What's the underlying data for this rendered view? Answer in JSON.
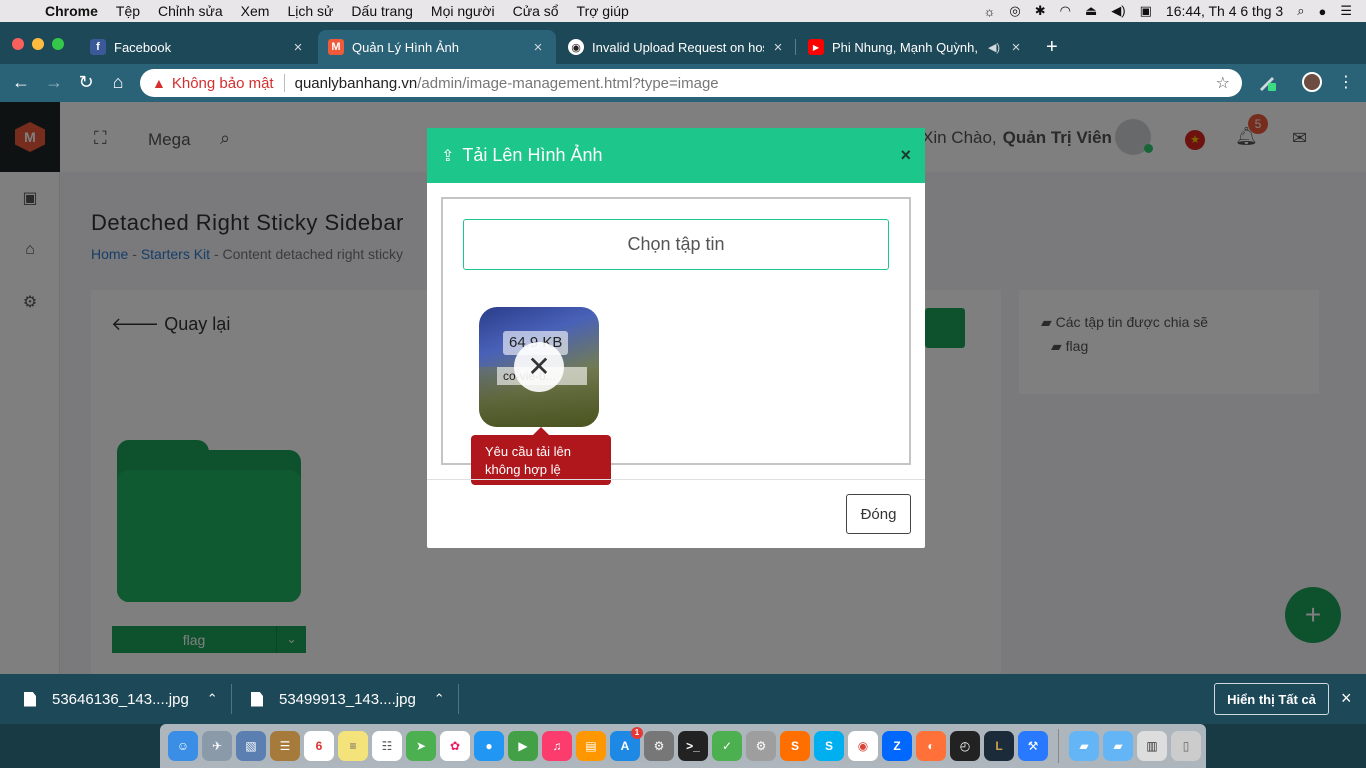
{
  "menubar": {
    "app": "Chrome",
    "items": [
      "Tệp",
      "Chỉnh sửa",
      "Xem",
      "Lịch sử",
      "Dấu trang",
      "Mọi người",
      "Cửa sổ",
      "Trợ giúp"
    ],
    "clock": "16:44, Th 4 6 thg 3"
  },
  "tabs": [
    {
      "label": "Facebook",
      "favicon": "f",
      "color": "#3b5998"
    },
    {
      "label": "Quản Lý Hình Ảnh",
      "favicon": "M",
      "color": "#ef5a3b"
    },
    {
      "label": "Invalid Upload Request on host",
      "favicon": "github-icon",
      "color": "#222222"
    },
    {
      "label": "Phi Nhung, Mạnh Quỳnh, N",
      "favicon": "youtube-icon",
      "color": "#ff0000"
    }
  ],
  "omnibox": {
    "security": "Không bảo mật",
    "host": "quanlybanhang.vn",
    "path": "/admin/image-management.html?type=image"
  },
  "app_header": {
    "logo": "M",
    "mega": "Mega",
    "greeting": "Xin Chào,",
    "user": "Quản Trị Viên",
    "notifications": "5"
  },
  "page": {
    "title": "Detached Right Sticky Sidebar",
    "breadcrumb": [
      "Home",
      "Starters Kit",
      "Content detached right sticky"
    ],
    "back_label": "Quay lại",
    "folder_name": "flag",
    "shared_header": "Các tập tin được chia sẽ",
    "shared_folder": "flag"
  },
  "modal": {
    "title": "Tải Lên Hình Ảnh",
    "choose_file": "Chọn tập tin",
    "file_size": "64.9 KB",
    "file_name": "co-vie-b...",
    "error_message": "Yêu cầu tải lên không hợp lệ",
    "close_label": "Đóng"
  },
  "downloads": {
    "items": [
      "53646136_143....jpg",
      "53499913_143....jpg"
    ],
    "show_all": "Hiển thị Tất cả"
  },
  "colors": {
    "accent": "#1dc68a",
    "error": "#b0171c",
    "brand_green": "#1aa55a",
    "toolbar": "#2a6377"
  }
}
